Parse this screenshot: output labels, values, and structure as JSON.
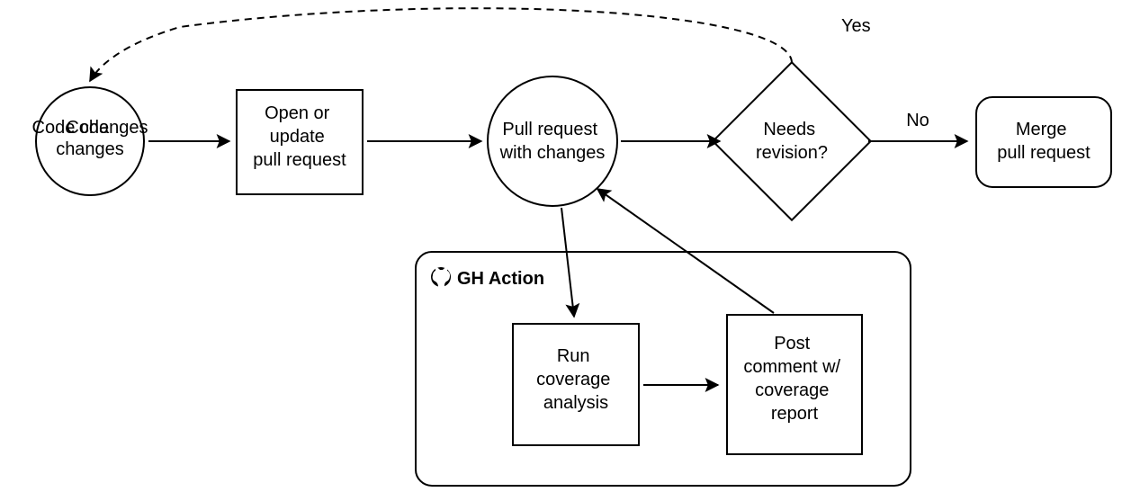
{
  "diagram": {
    "nodes": {
      "code_changes": "Code changes",
      "open_pr_l1": "Open or",
      "open_pr_l2": "update",
      "open_pr_l3": "pull request",
      "pr_changes_l1": "Pull request",
      "pr_changes_l2": "with changes",
      "needs_rev_l1": "Needs",
      "needs_rev_l2": "revision?",
      "merge_l1": "Merge",
      "merge_l2": "pull request",
      "run_cov_l1": "Run",
      "run_cov_l2": "coverage",
      "run_cov_l3": "analysis",
      "post_l1": "Post",
      "post_l2": "comment w/",
      "post_l3": "coverage",
      "post_l4": "report"
    },
    "edges": {
      "yes": "Yes",
      "no": "No"
    },
    "subgraph": {
      "title": "GH Action"
    }
  }
}
